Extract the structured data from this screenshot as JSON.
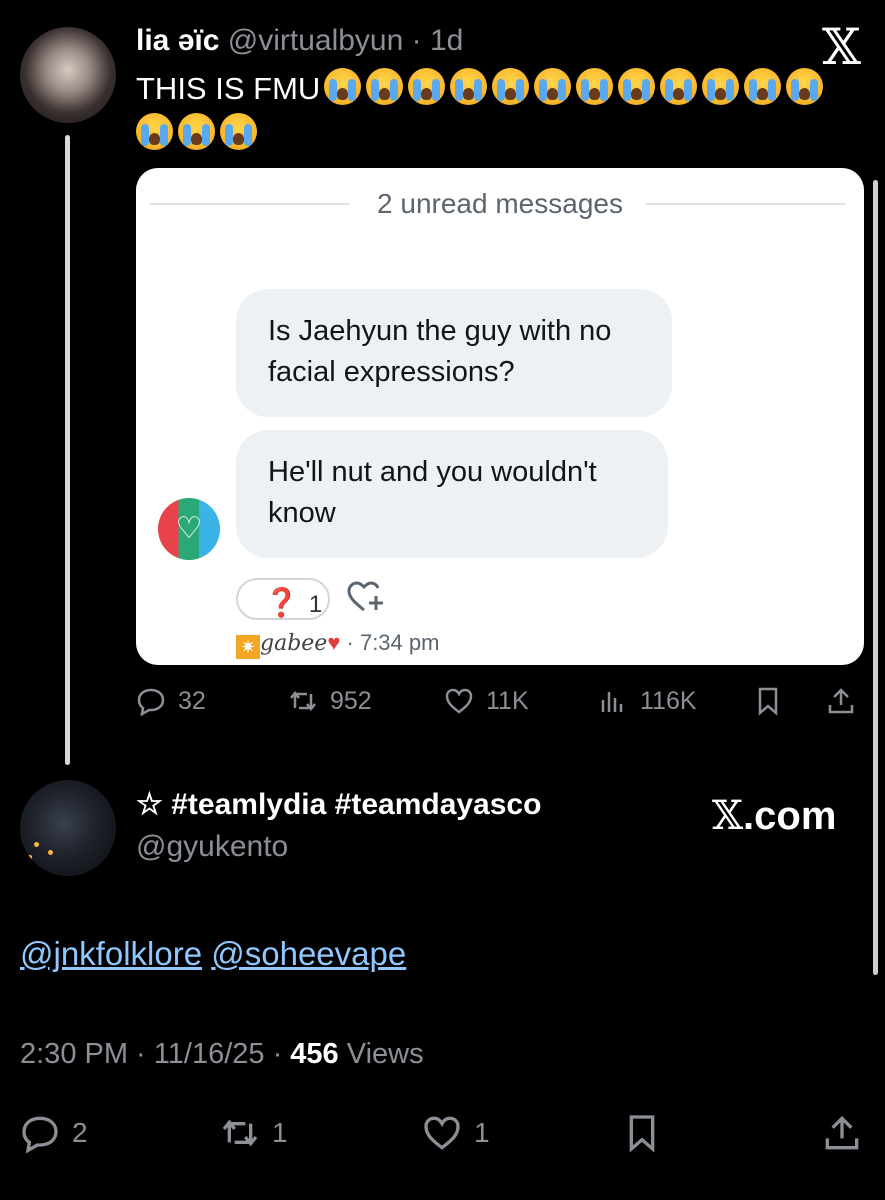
{
  "tweet": {
    "display_name": "lia əïc",
    "handle": "@virtualbyun",
    "age": "1d",
    "text": "THIS IS FMU",
    "emoji_count": 15,
    "brand_icon": "x-logo-icon",
    "embedded_dm": {
      "unread_label": "2 unread messages",
      "messages": [
        "Is Jaehyun the guy with no facial expressions?",
        "He'll nut and you wouldn't know"
      ],
      "reaction_emoji": "❓",
      "reaction_count": "1",
      "sender_name": "gabee",
      "sender_time": "7:34 pm"
    },
    "stats": {
      "replies": "32",
      "reposts": "952",
      "likes": "11K",
      "views": "116K"
    }
  },
  "reply": {
    "display_name": "☆ #teamlydia #teamdayasco",
    "handle": "@gyukento",
    "watermark": "X.com",
    "mentions": [
      "@jnkfolklore",
      "@soheevape"
    ],
    "time": "2:30 PM",
    "date": "11/16/25",
    "views_count": "456",
    "views_label": "Views",
    "stats": {
      "replies": "2",
      "reposts": "1",
      "likes": "1"
    }
  }
}
